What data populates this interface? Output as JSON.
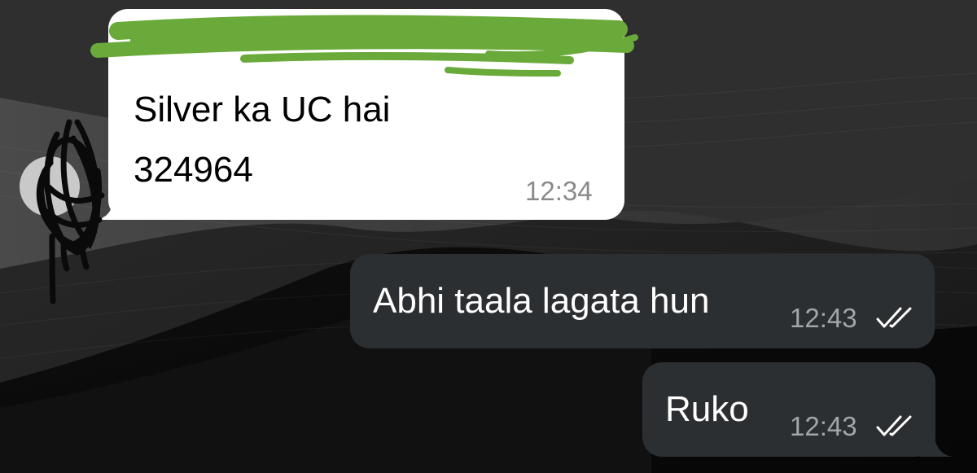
{
  "messages": [
    {
      "direction": "incoming",
      "sender_redacted": true,
      "lines": [
        "Silver ka UC hai",
        "324964"
      ],
      "time": "12:34"
    },
    {
      "direction": "outgoing",
      "text": "Abhi taala lagata hun",
      "time": "12:43",
      "status_icon": "double-check-icon"
    },
    {
      "direction": "outgoing",
      "text": "Ruko",
      "time": "12:43",
      "status_icon": "double-check-icon"
    }
  ],
  "colors": {
    "incoming_bubble": "#ffffff",
    "outgoing_bubble": "#2c2f31",
    "redaction_green": "#6aaa3a",
    "redaction_black": "#0a0a0a"
  }
}
